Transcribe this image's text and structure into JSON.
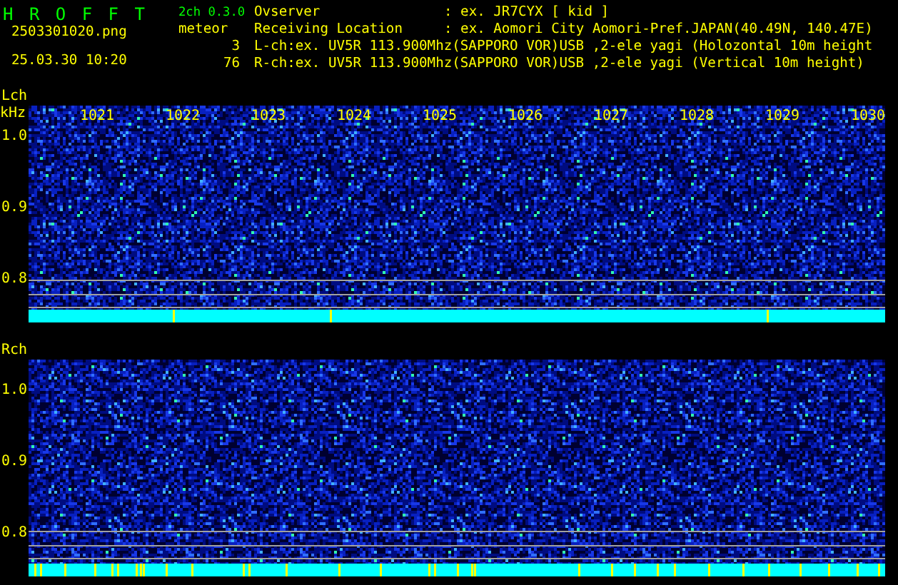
{
  "app": {
    "title": "H R O F F T",
    "version": "2ch 0.3.0"
  },
  "file": {
    "name": "2503301020.png",
    "datetime": "25.03.30 10:20"
  },
  "meteor": {
    "label": "meteor",
    "counts": [
      "3",
      "76"
    ]
  },
  "info": [
    {
      "label": "Ovserver",
      "value": ": ex. JR7CYX [ kid ]"
    },
    {
      "label": "Receiving Location",
      "value": ": ex. Aomori City Aomori-Pref.JAPAN(40.49N, 140.47E)"
    },
    {
      "label": "L-ch:ex. UV5R 113.900Mhz(SAPPORO VOR)USB ,2-ele yagi (Holozontal 10m height"
    },
    {
      "label": "R-ch:ex. UV5R 113.900Mhz(SAPPORO VOR)USB ,2-ele yagi (Vertical 10m height)"
    }
  ],
  "panels": [
    {
      "channel": "Lch",
      "unit": "kHz",
      "time_labels": [
        "1021",
        "1022",
        "1023",
        "1024",
        "1025",
        "1026",
        "1027",
        "1028",
        "1029",
        "1030"
      ],
      "y_labels": [
        "1.0",
        "0.9",
        "0.8"
      ]
    },
    {
      "channel": "Rch",
      "y_labels": [
        "1.0",
        "0.9",
        "0.8"
      ]
    }
  ]
}
